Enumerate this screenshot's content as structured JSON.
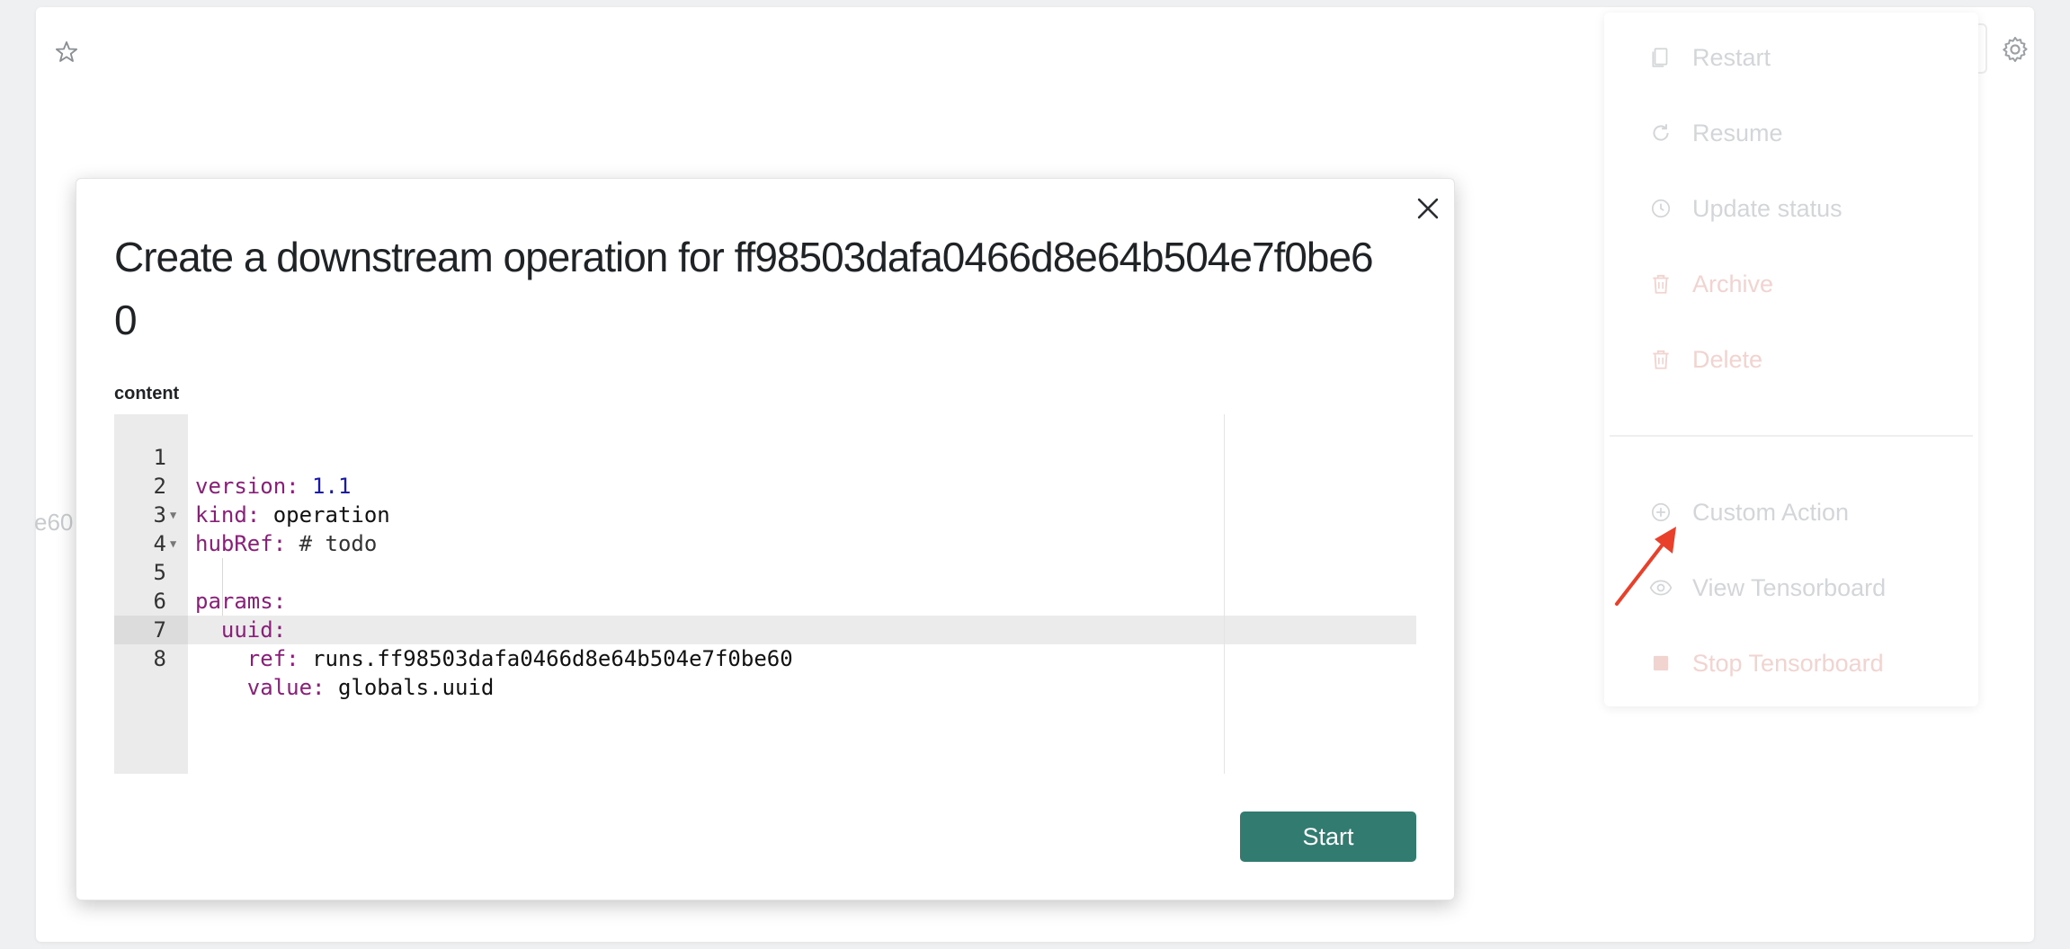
{
  "background": {
    "partial_text": "e60",
    "menu": {
      "items": [
        {
          "label": "Restart",
          "icon": "copy-icon",
          "color": "#d3d6d8"
        },
        {
          "label": "Resume",
          "icon": "refresh-icon",
          "color": "#d3d6d8"
        },
        {
          "label": "Update status",
          "icon": "clock-icon",
          "color": "#d3d6d8"
        },
        {
          "label": "Archive",
          "icon": "trash-icon",
          "color": "#f1d3d0"
        },
        {
          "label": "Delete",
          "icon": "trash-icon",
          "color": "#f1d3d0"
        },
        {
          "label": "Custom Action",
          "icon": "plus-circle-icon",
          "color": "#d3d6d8"
        },
        {
          "label": "View Tensorboard",
          "icon": "eye-icon",
          "color": "#d3d6d8"
        },
        {
          "label": "Stop Tensorboard",
          "icon": "stop-icon",
          "color": "#f1d3d0"
        }
      ]
    },
    "annotation_arrow_color": "#e8402a"
  },
  "modal": {
    "title": "Create a downstream operation for ff98503dafa0466d8e64b504e7f0be60",
    "field_label": "content",
    "editor": {
      "lines": [
        {
          "n": "1",
          "key": "version:",
          "value": "1.1",
          "value_type": "number"
        },
        {
          "n": "2",
          "key": "kind:",
          "value": "operation",
          "value_type": "text"
        },
        {
          "n": "3",
          "key": "hubRef:",
          "value": "# todo",
          "value_type": "comment"
        },
        {
          "n": "4",
          "key": "params:",
          "value": "",
          "value_type": "text",
          "fold": true
        },
        {
          "n": "5",
          "key": "uuid:",
          "value": "",
          "value_type": "text",
          "fold": true,
          "indent": 1
        },
        {
          "n": "6",
          "key": "ref:",
          "value": "runs.ff98503dafa0466d8e64b504e7f0be60",
          "value_type": "text",
          "indent": 2
        },
        {
          "n": "7",
          "key": "value:",
          "value": "globals.uuid",
          "value_type": "text",
          "indent": 2
        },
        {
          "n": "8",
          "key": "",
          "value": "",
          "value_type": "text",
          "active": true
        }
      ]
    },
    "start_label": "Start",
    "colors": {
      "accent": "#327b71",
      "yaml_key": "#8a1f7a",
      "yaml_number": "#1a1aa6"
    }
  }
}
